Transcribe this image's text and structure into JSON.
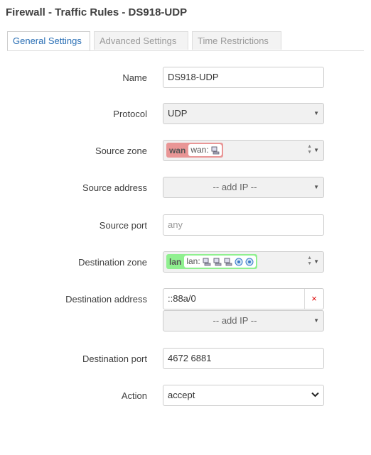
{
  "page": {
    "title": "Firewall - Traffic Rules - DS918-UDP"
  },
  "tabs": [
    {
      "label": "General Settings",
      "active": true
    },
    {
      "label": "Advanced Settings",
      "active": false
    },
    {
      "label": "Time Restrictions",
      "active": false
    }
  ],
  "form": {
    "name": {
      "label": "Name",
      "value": "DS918-UDP"
    },
    "protocol": {
      "label": "Protocol",
      "value": "UDP"
    },
    "source_zone": {
      "label": "Source zone",
      "zone": "wan",
      "networks_label": "wan:",
      "color": "#e99696"
    },
    "source_address": {
      "label": "Source address",
      "placeholder": "-- add IP --"
    },
    "source_port": {
      "label": "Source port",
      "placeholder": "any"
    },
    "destination_zone": {
      "label": "Destination zone",
      "zone": "lan",
      "networks_label": "lan:",
      "color": "#90f090"
    },
    "destination_address": {
      "label": "Destination address",
      "value": "::88a/0",
      "remove": "×",
      "placeholder": "-- add IP --"
    },
    "destination_port": {
      "label": "Destination port",
      "value": "4672 6881"
    },
    "action": {
      "label": "Action",
      "value": "accept"
    }
  },
  "colors": {
    "accent": "#2a6fb5",
    "remove": "#dd0000"
  }
}
